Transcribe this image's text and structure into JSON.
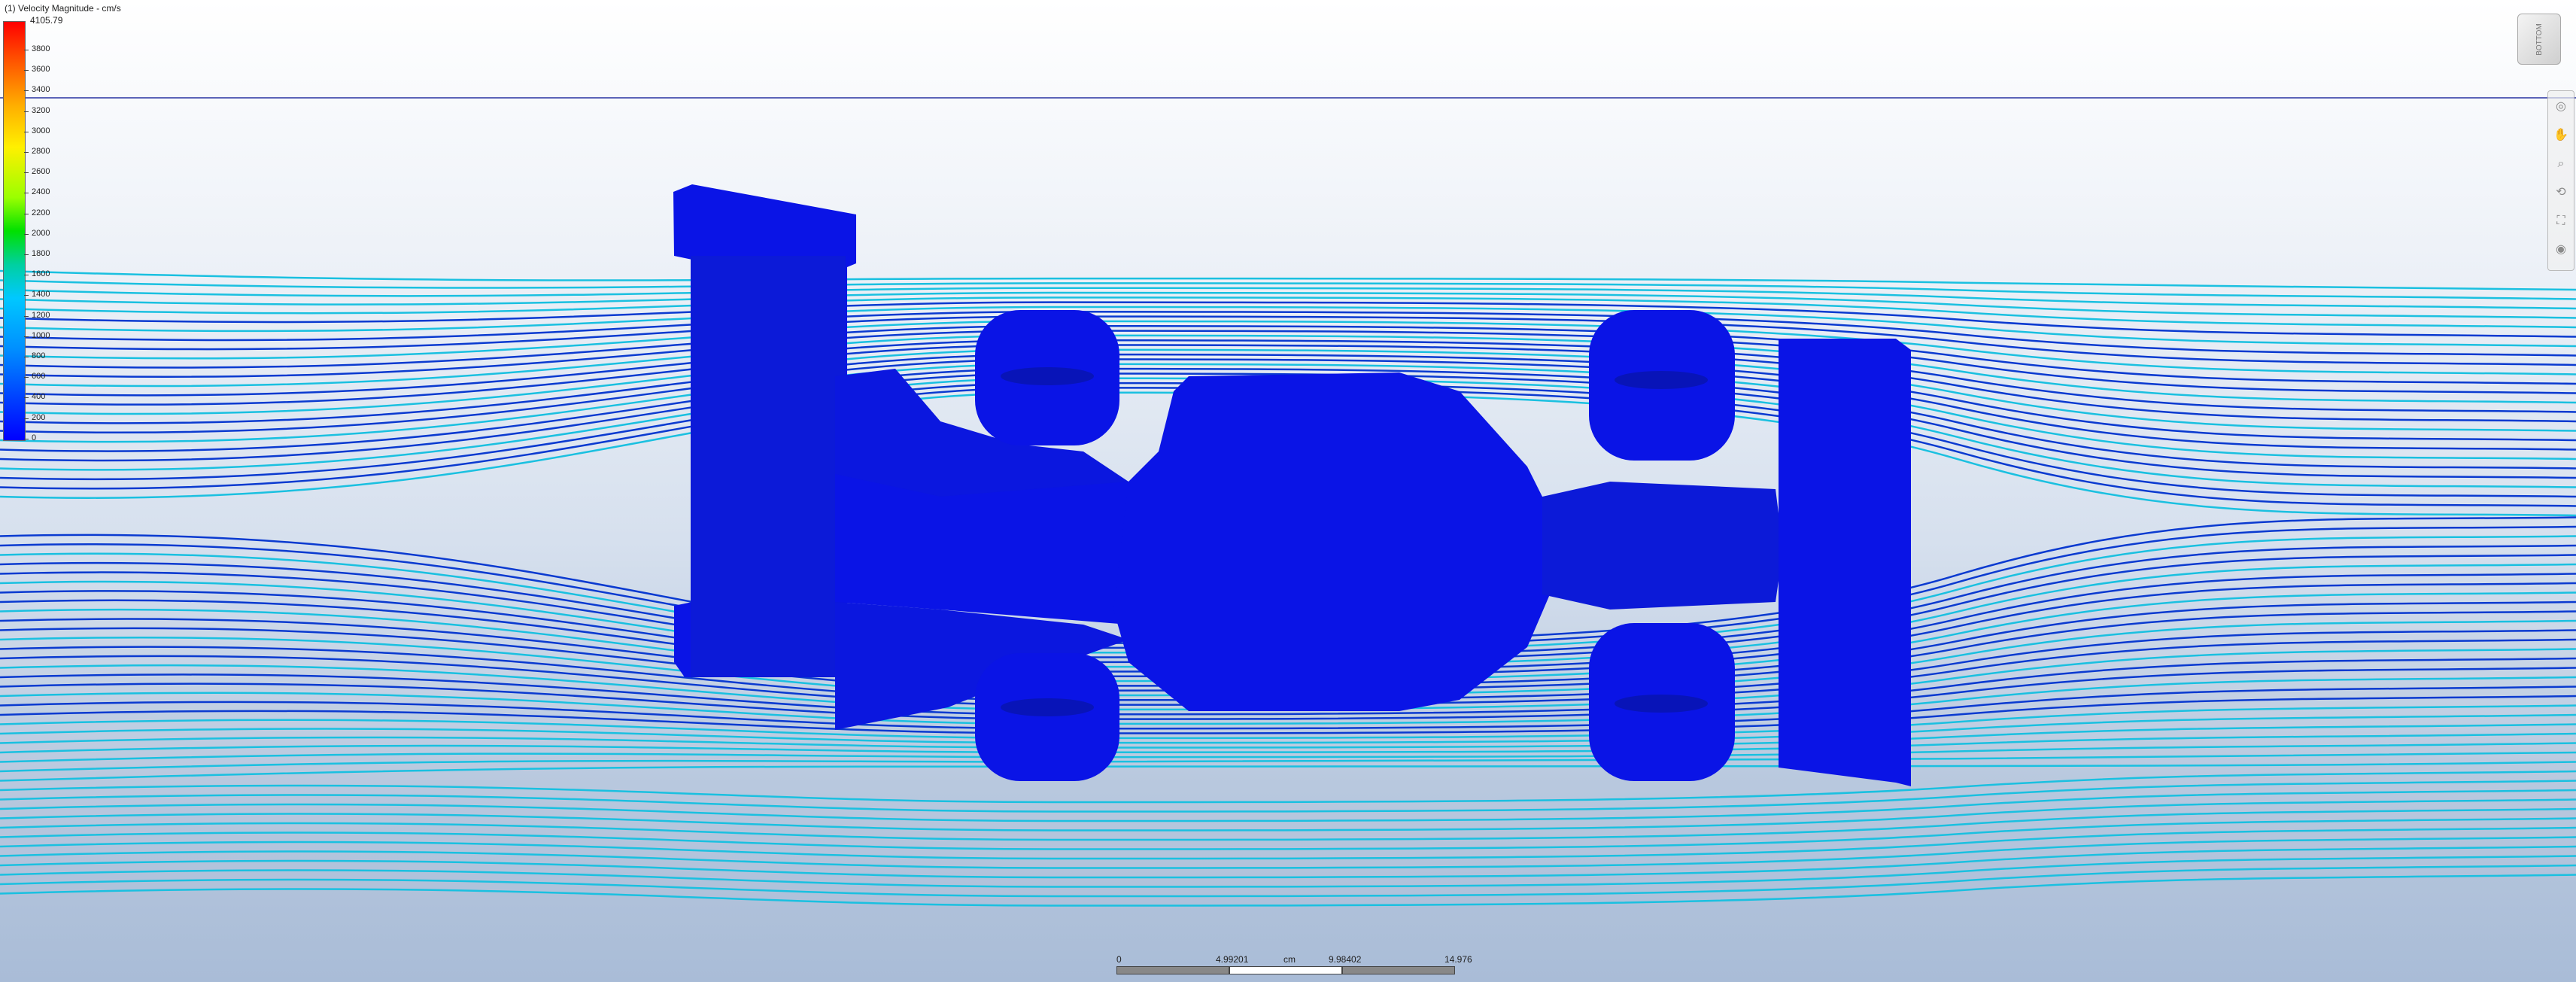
{
  "legend": {
    "title": "(1) Velocity Magnitude - cm/s",
    "max_label": "4105.79",
    "ticks": [
      "3800",
      "3600",
      "3400",
      "3200",
      "3000",
      "2800",
      "2600",
      "2400",
      "2200",
      "2000",
      "1800",
      "1600",
      "1400",
      "1200",
      "1000",
      "800",
      "600",
      "400",
      "200",
      "0"
    ]
  },
  "viewcube": {
    "face_label": "BOTTOM",
    "icon": "view-cube-icon"
  },
  "navigation": {
    "items": [
      "wheel-icon",
      "pan-icon",
      "zoom-icon",
      "orbit-icon",
      "fit-icon",
      "look-icon"
    ]
  },
  "scale": {
    "labels": [
      "0",
      "4.99201",
      "cm",
      "9.98402",
      "14.976"
    ]
  },
  "colors": {
    "car_body": "#0a14e6",
    "streamline_fast": "#1ac0e0",
    "streamline_slow": "#0a3ad0",
    "horizon": "#5b64b8"
  }
}
